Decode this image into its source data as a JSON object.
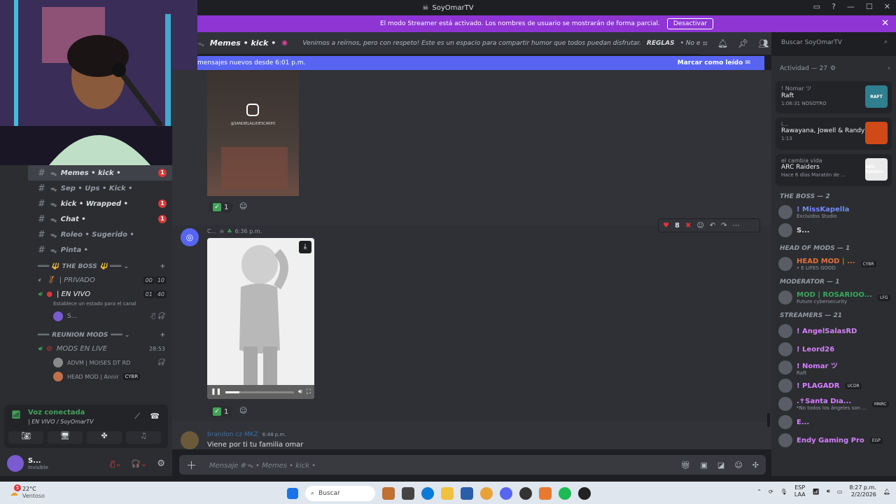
{
  "window": {
    "title": "SoyOmarTV",
    "controls": [
      "▭",
      "?",
      "—",
      "☐",
      "✕"
    ]
  },
  "banner": {
    "text": "El modo Streamer está activado. Los nombres de usuario se mostrarán de forma parcial.",
    "button": "Desactivar",
    "color": "#8e35d4"
  },
  "channel_header": {
    "name": "Memes • kick •",
    "topic": "Venimos a reírnos, pero con respeto! Este es un espacio para compartir humor que todos puedan disfrutar.",
    "rules_label": "REGLAS",
    "rules_text": "• No envíes memes que co...",
    "search_placeholder": "Buscar SoyOmarTV"
  },
  "new_messages": {
    "text": "mensajes nuevos desde 6:01 p.m.",
    "action": "Marcar como leído"
  },
  "left_channels": [
    {
      "name": "Memes • kick •",
      "badge": "1",
      "active": true
    },
    {
      "name": "Sep • Ups • Kick •",
      "badge": "",
      "active": false
    },
    {
      "name": "kick • Wrapped •",
      "badge": "1",
      "active": false
    },
    {
      "name": "Chat •",
      "badge": "1",
      "active": false
    },
    {
      "name": "Roleo • Sugerido •",
      "badge": "",
      "active": false
    },
    {
      "name": "Pinta •",
      "badge": "",
      "active": false
    }
  ],
  "voice_category_1": {
    "title": "THE BOSS",
    "rooms": [
      {
        "name": "| PRIVADO",
        "count_a": "00",
        "count_b": "10"
      },
      {
        "name": "| EN VIVO",
        "count_a": "01",
        "count_b": "40"
      }
    ],
    "status_hint": "Establece un estado para el canal",
    "member": "S..."
  },
  "voice_category_2": {
    "title": "REUNION MODS",
    "room": "MODS EN LIVE",
    "time": "28:53",
    "members": [
      {
        "name": "ADVM | MOISES DT RD",
        "tag": ""
      },
      {
        "name": "HEAD MOD | Annir",
        "tag": "CYBR"
      }
    ]
  },
  "voice_panel": {
    "status": "Voz conectada",
    "channel": "| EN VIVO / SoyOmarTV"
  },
  "user_panel": {
    "name": "S...",
    "status": "Invisible",
    "notif": "5"
  },
  "messages": [
    {
      "type": "media",
      "overlay_text": "@SANDIELALUDESCARPO",
      "reaction_count": "1"
    },
    {
      "type": "video",
      "author": "C...",
      "time": "6:36 p.m.",
      "reaction_count": "1",
      "hover_reaction_count": "8"
    },
    {
      "type": "text",
      "author": "brandon cz MKZ",
      "time": "6:48 p.m.",
      "text": "Viene por ti tu familia omar"
    }
  ],
  "composer": {
    "placeholder": "Mensaje #ᯓ • Memes • kick •"
  },
  "members": {
    "activity_title": "Actividad — 27",
    "activities": [
      {
        "user": "! Nomar ツ",
        "game": "Raft",
        "detail": "1:06:31",
        "extra": "NOSOTRO",
        "thumb_color": "#2f7f8f",
        "thumb_label": "RAFT"
      },
      {
        "user": "i...",
        "game": "Rawayana, Jowell & Randy",
        "detail": "1:13",
        "extra": "",
        "thumb_color": "#d04a18",
        "thumb_label": ""
      },
      {
        "user": "el cambia vida",
        "game": "ARC Raiders",
        "detail": "Hace 6 días",
        "extra": "Maratón de ...",
        "thumb_color": "#e9e9e9",
        "thumb_label": "ARC Raiders"
      }
    ],
    "groups": [
      {
        "title": "THE BOSS — 2",
        "people": [
          {
            "name": "! MissKapella",
            "sub": "Excluidos Studio",
            "color": "#7289ff",
            "tag": ""
          },
          {
            "name": "S...",
            "sub": "",
            "color": "#dbdee1",
            "tag": ""
          }
        ]
      },
      {
        "title": "HEAD OF MODS — 1",
        "people": [
          {
            "name": "HEAD MOD | ...",
            "sub": "• E LIFES GOOD",
            "color": "#e0703c",
            "tag": "CYBR"
          }
        ]
      },
      {
        "title": "MODERATOR — 1",
        "people": [
          {
            "name": "MOD | ROSARIOO...",
            "sub": "Future cybersecurity",
            "color": "#3ba55d",
            "tag": "LFG"
          }
        ]
      },
      {
        "title": "STREAMERS — 21",
        "people": [
          {
            "name": "! AngelSalasRD",
            "sub": "",
            "color": "#d580ff",
            "tag": ""
          },
          {
            "name": "! Leord26",
            "sub": "",
            "color": "#d580ff",
            "tag": ""
          },
          {
            "name": "! Nomar ツ",
            "sub": "Raft",
            "color": "#d580ff",
            "tag": ""
          },
          {
            "name": "! PLAGADR",
            "sub": "",
            "color": "#d580ff",
            "tag": "UCDR"
          },
          {
            "name": ".✝Santa Dıa...",
            "sub": "*No todos los ángeles son ...",
            "color": "#d580ff",
            "tag": "MNRC"
          },
          {
            "name": "E...",
            "sub": "",
            "color": "#d580ff",
            "tag": ""
          },
          {
            "name": "Endy Gaming Pro",
            "sub": "",
            "color": "#d580ff",
            "tag": "EGP"
          }
        ]
      }
    ]
  },
  "taskbar": {
    "weather_temp": "22°C",
    "weather_desc": "Ventoso",
    "search": "Buscar",
    "lang": "ESP",
    "lang2": "LAA",
    "time": "8:27 p.m.",
    "date": "2/2/2026"
  }
}
